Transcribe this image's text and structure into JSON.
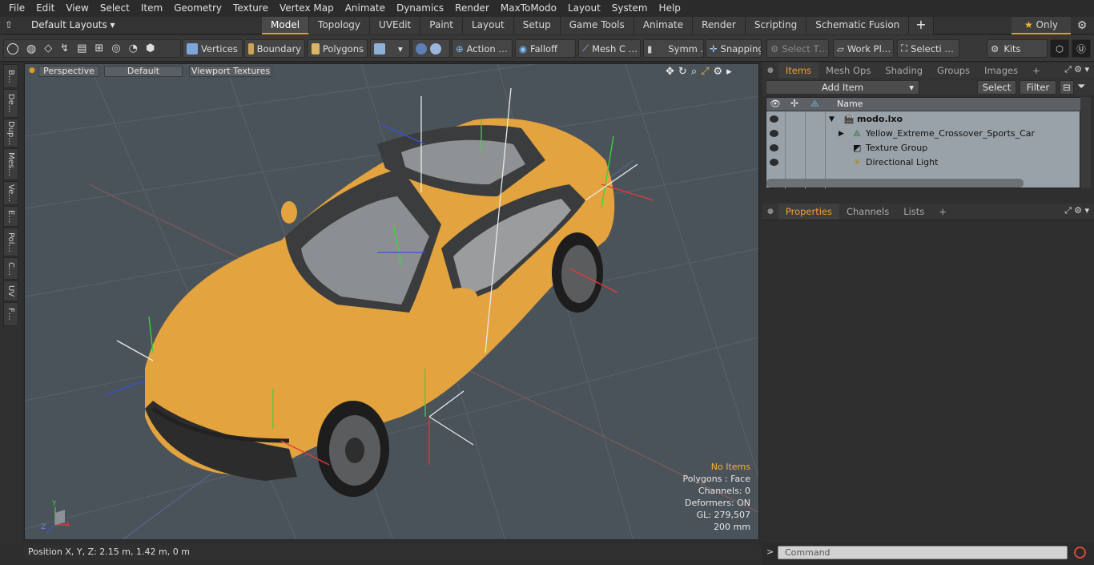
{
  "menu": [
    "File",
    "Edit",
    "View",
    "Select",
    "Item",
    "Geometry",
    "Texture",
    "Vertex Map",
    "Animate",
    "Dynamics",
    "Render",
    "MaxToModo",
    "Layout",
    "System",
    "Help"
  ],
  "layouts": "Default Layouts ▾",
  "tabs": [
    "Model",
    "Topology",
    "UVEdit",
    "Paint",
    "Layout",
    "Setup",
    "Game Tools",
    "Animate",
    "Render",
    "Scripting",
    "Schematic Fusion"
  ],
  "active_tab": "Model",
  "only_label": "Only",
  "toolbar": {
    "vertices": "Vertices",
    "boundary": "Boundary",
    "polygons": "Polygons",
    "action": "Action …",
    "falloff": "Falloff",
    "mesh": "Mesh C …",
    "symm": "Symm …",
    "snapping": "Snapping",
    "select_t": "Select T…",
    "work_pl": "Work Pl…",
    "selecti": "Selecti …",
    "kits": "Kits"
  },
  "left_tools": [
    "B…",
    "De…",
    "Dup…",
    "Mes…",
    "Ve…",
    "E…",
    "Pol…",
    "C…",
    "UV",
    "F…"
  ],
  "viewport": {
    "perspective": "Perspective",
    "default": "Default",
    "textures": "Viewport Textures"
  },
  "stats": {
    "no_items": "No Items",
    "polygons": "Polygons : Face",
    "channels": "Channels: 0",
    "deformers": "Deformers: ON",
    "gl": "GL: 279,507",
    "scale": "200 mm"
  },
  "status": "Position X, Y, Z:   2.15 m, 1.42 m, 0 m",
  "panel_tabs": [
    "Items",
    "Mesh Ops",
    "Shading",
    "Groups",
    "Images"
  ],
  "add_item": "Add Item",
  "select_btn": "Select",
  "filter_btn": "Filter",
  "tree_header": "Name",
  "tree": [
    "modo.lxo",
    "Yellow_Extreme_Crossover_Sports_Car",
    "Texture Group",
    "Directional Light"
  ],
  "prop_tabs": [
    "Properties",
    "Channels",
    "Lists"
  ],
  "command_placeholder": "Command",
  "colors": {
    "accent": "#e09a2a",
    "car_body": "#e8a53c"
  }
}
